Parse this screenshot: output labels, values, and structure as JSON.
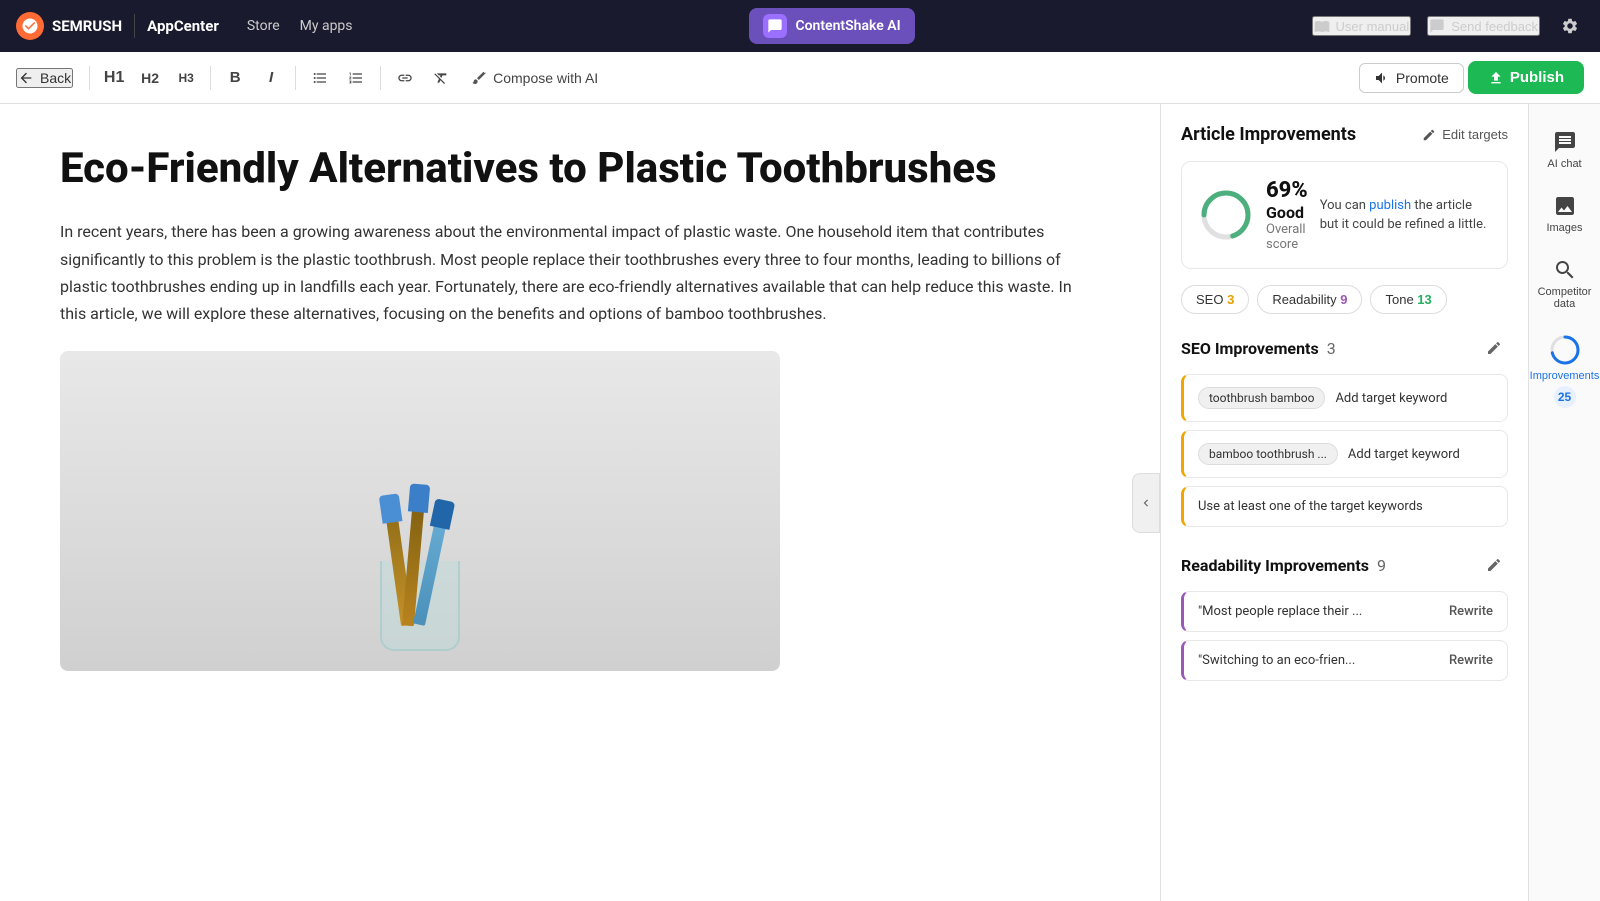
{
  "nav": {
    "logo": "S",
    "brand": "SEMRUSH",
    "appcenter": "AppCenter",
    "store": "Store",
    "myapps": "My apps",
    "app_name": "ContentShake AI",
    "user_manual": "User manual",
    "send_feedback": "Send feedback"
  },
  "toolbar": {
    "back": "Back",
    "h1": "H1",
    "h2": "H2",
    "h3": "H3",
    "bold": "B",
    "italic": "I",
    "compose_ai": "Compose with AI",
    "promote": "Promote",
    "publish": "Publish"
  },
  "article": {
    "title": "Eco-Friendly Alternatives to Plastic Toothbrushes",
    "body": "In recent years, there has been a growing awareness about the environmental impact of plastic waste. One household item that contributes significantly to this problem is the plastic toothbrush. Most people replace their toothbrushes every three to four months, leading to billions of plastic toothbrushes ending up in landfills each year. Fortunately, there are eco-friendly alternatives available that can help reduce this waste. In this article, we will explore these alternatives, focusing on the benefits and options of bamboo toothbrushes."
  },
  "panel": {
    "title": "Article Improvements",
    "edit_targets": "Edit targets",
    "score_value": "69%",
    "score_label": "Good",
    "overall_score": "Overall score",
    "score_desc_pre": "You can ",
    "score_desc_link": "publish",
    "score_desc_post": " the article but it could be refined a little.",
    "tabs": [
      {
        "label": "SEO",
        "count": "3",
        "count_class": "seo-count"
      },
      {
        "label": "Readability",
        "count": "9",
        "count_class": "readability-count"
      },
      {
        "label": "Tone",
        "count": "13",
        "count_class": "tone-count"
      }
    ],
    "seo_title": "SEO Improvements",
    "seo_count": "3",
    "readability_title": "Readability Improvements",
    "readability_count": "9",
    "seo_improvements": [
      {
        "keyword": "toothbrush bamboo",
        "action": "Add target keyword"
      },
      {
        "keyword": "bamboo toothbrush ...",
        "action": "Add target keyword"
      }
    ],
    "seo_note": "Use at least one of the target keywords",
    "readability_improvements": [
      {
        "quote": "\"Most people replace their ...",
        "action": "Rewrite"
      },
      {
        "quote": "\"Switching to an eco-frien...",
        "action": "Rewrite"
      }
    ]
  },
  "side_icons": [
    {
      "name": "AI chat",
      "label": "AI chat",
      "icon": "chat"
    },
    {
      "name": "Images",
      "label": "Images",
      "icon": "image"
    },
    {
      "name": "Competitor data",
      "label": "Competitor data",
      "icon": "search"
    },
    {
      "name": "Improvements 25",
      "label": "Improvements",
      "count": "25",
      "icon": "improvements",
      "active": true
    }
  ]
}
